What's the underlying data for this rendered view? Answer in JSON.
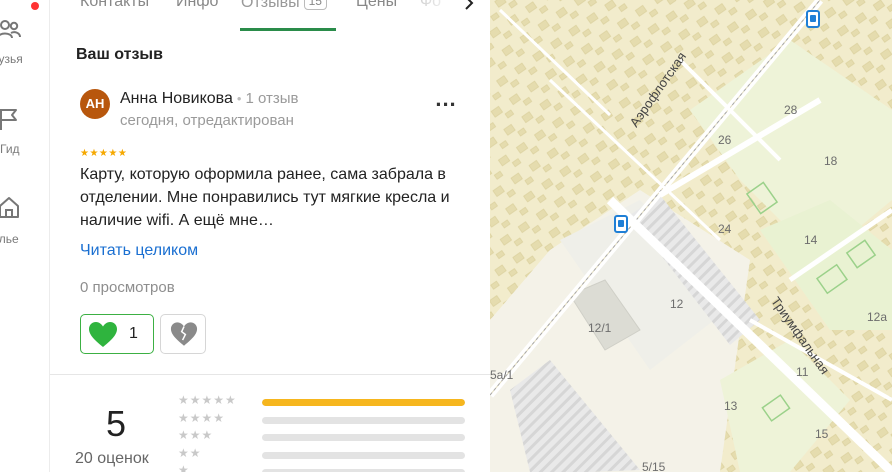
{
  "rail": {
    "items": [
      {
        "label": "рузья",
        "icon": "friends-icon"
      },
      {
        "label": "Гид",
        "icon": "guide-flag-icon"
      },
      {
        "label": "илье",
        "icon": "housing-icon"
      }
    ]
  },
  "tabs": {
    "items": [
      "Контакты",
      "Инфо",
      "Отзывы",
      "Цены",
      "Фо"
    ],
    "reviews_count": "15"
  },
  "review": {
    "section_title": "Ваш отзыв",
    "avatar_initials": "АН",
    "author": "Анна Новикова",
    "author_meta": "1 отзыв",
    "date": "сегодня, отредактирован",
    "more": "...",
    "stars": "★★★★★",
    "text": "Карту, которую оформила ранее, сама забрала в отделении. Мне понравились тут мягкие кресла и наличие wifi. А ещё мне…",
    "read_more": "Читать целиком",
    "views": "0 просмотров",
    "likes": "1"
  },
  "rating": {
    "value": "5",
    "count_label": "20 оценок",
    "distribution": [
      {
        "stars": 5,
        "label": "★★★★★",
        "fraction": 1.0
      },
      {
        "stars": 4,
        "label": "★★★★",
        "fraction": 0.0
      },
      {
        "stars": 3,
        "label": "★★★",
        "fraction": 0.0
      },
      {
        "stars": 2,
        "label": "★★",
        "fraction": 0.0
      },
      {
        "stars": 1,
        "label": "★",
        "fraction": 0.0
      }
    ]
  },
  "map": {
    "streets": [
      "Аэрофлотская",
      "Триумфальная"
    ],
    "house_numbers": [
      "28",
      "26",
      "18",
      "24",
      "14",
      "12",
      "12/1",
      "11",
      "13",
      "15",
      "12а",
      "5а/1",
      "5/15"
    ]
  },
  "colors": {
    "accent_green": "#2a8c4a",
    "like_green": "#3cb043",
    "link_blue": "#1a6fd1",
    "star_orange": "#f5a800",
    "avatar_brown": "#b8570d"
  }
}
